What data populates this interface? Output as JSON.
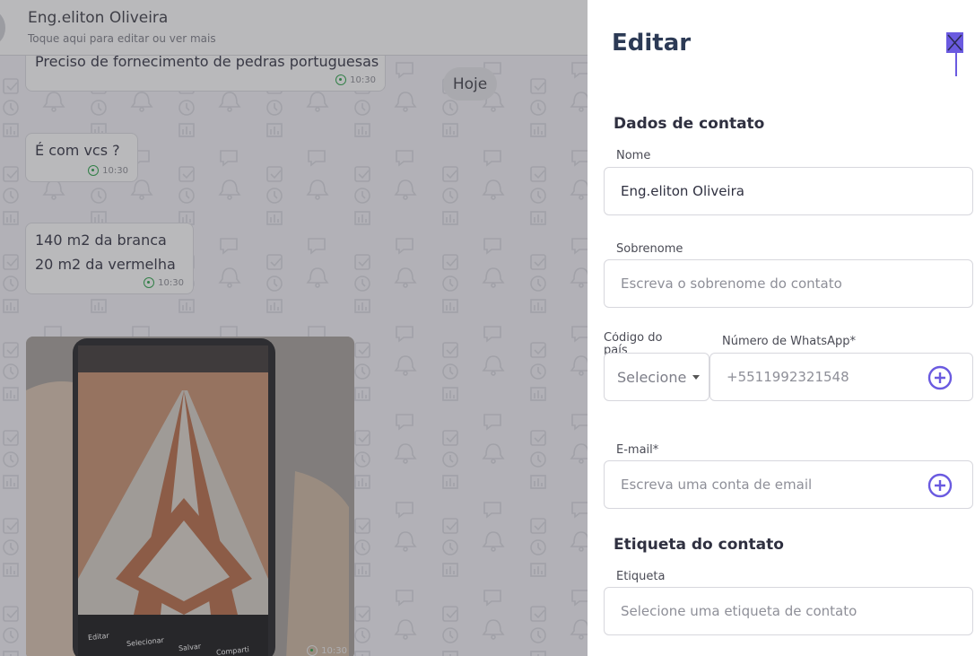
{
  "chat": {
    "contact_name": "Eng.eliton Oliveira",
    "contact_subtitle": "Toque aqui para editar ou ver mais",
    "day_separator": "Hoje",
    "messages": [
      {
        "text": "Preciso de fornecimento de pedras portuguesas",
        "time": "10:30"
      },
      {
        "text": "É com vcs ?",
        "time": "10:30"
      },
      {
        "line1": "140 m2 da branca",
        "line2": "20 m2 da vermelha",
        "time": "10:30"
      }
    ],
    "image_message": {
      "time": "10:30",
      "phone_actions": [
        "Editar",
        "Selecionar",
        "Salvar",
        "Comparti"
      ]
    }
  },
  "panel": {
    "title": "Editar",
    "section_contact": "Dados de contato",
    "name_label": "Nome",
    "name_value": "Eng.eliton Oliveira",
    "surname_label": "Sobrenome",
    "surname_placeholder": "Escreva o sobrenome do contato",
    "country_label": "Código do país",
    "country_value": "Selecione",
    "whatsapp_label": "Número de WhatsApp*",
    "whatsapp_placeholder": "+5511992321548",
    "email_label": "E-mail*",
    "email_placeholder": "Escreva uma conta de email",
    "section_tag": "Etiqueta do contato",
    "tag_label": "Etiqueta",
    "tag_placeholder": "Selecione uma etiqueta de contato"
  },
  "colors": {
    "accent": "#6a5ae0",
    "title": "#2c3a55",
    "whatsapp": "#25a244"
  }
}
